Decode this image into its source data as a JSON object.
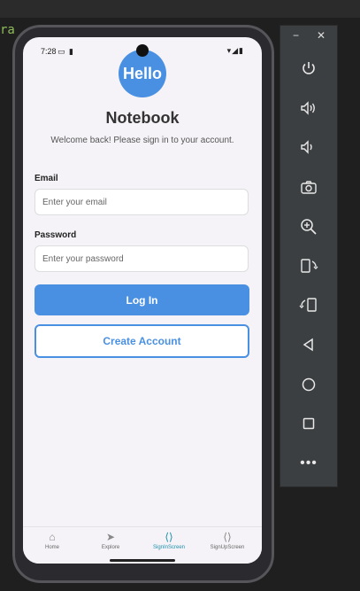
{
  "ide": {
    "code_fragment": "ra"
  },
  "status_bar": {
    "time": "7:28"
  },
  "app": {
    "avatar_text": "Hello",
    "title": "Notebook",
    "subtitle": "Welcome back! Please sign in to your account.",
    "email": {
      "label": "Email",
      "placeholder": "Enter your email",
      "value": ""
    },
    "password": {
      "label": "Password",
      "placeholder": "Enter your password",
      "value": ""
    },
    "login_label": "Log In",
    "create_account_label": "Create Account"
  },
  "tabs": [
    {
      "label": "Home",
      "icon": "home-icon"
    },
    {
      "label": "Explore",
      "icon": "paper-plane-icon"
    },
    {
      "label": "SignInScreen",
      "icon": "code-icon",
      "active": true
    },
    {
      "label": "SignUpScreen",
      "icon": "code-icon"
    }
  ],
  "colors": {
    "accent": "#4a90e2",
    "active_tab": "#1d8fae",
    "screen_bg": "#f5f3f7"
  },
  "emulator_panel": {
    "buttons": [
      "minimize",
      "close",
      "power",
      "volume-up",
      "volume-down",
      "camera",
      "zoom-in",
      "rotate-left",
      "rotate-right",
      "back",
      "home",
      "overview",
      "more"
    ]
  }
}
